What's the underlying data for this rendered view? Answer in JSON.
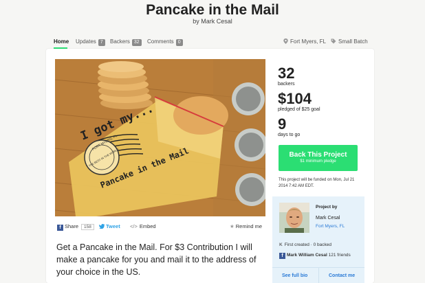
{
  "project": {
    "title": "Pancake in the Mail",
    "byline": "by Mark Cesal"
  },
  "nav": {
    "home": "Home",
    "updates": "Updates",
    "updates_count": "7",
    "backers": "Backers",
    "backers_count": "32",
    "comments": "Comments",
    "comments_count": "0",
    "location": "Fort Myers, FL",
    "category": "Small Batch"
  },
  "hero_image": {
    "bag_text_1": "I got my...",
    "bag_text_2": "Pancake in the Mail",
    "stamp_text_top": "FORT MYERS, FL",
    "stamp_text_bottom": "THE BEST IN THE WORLD"
  },
  "share": {
    "facebook_label": "Share",
    "facebook_count": "158",
    "tweet_label": "Tweet",
    "embed_label": "Embed",
    "remind_label": "Remind me"
  },
  "description": "Get a Pancake in the Mail. For $3 Contribution I will make a pancake for you and mail it to the address of your choice in the US.",
  "stats": {
    "backers_value": "32",
    "backers_label": "backers",
    "pledged_value": "$104",
    "pledged_label": "pledged of $25 goal",
    "days_value": "9",
    "days_label": "days to go"
  },
  "back_button": {
    "label": "Back This Project",
    "sub": "$1 minimum pledge"
  },
  "funded_note": "This project will be funded on Mon, Jul 21 2014 7:42 AM EDT.",
  "creator": {
    "label": "Project by",
    "name": "Mark Cesal",
    "location": "Fort Myers, FL",
    "history": "First created · 0 backed",
    "facebook_name": "Mark William Cesal",
    "facebook_friends": "121 friends",
    "bio_link": "See full bio",
    "contact_link": "Contact me"
  },
  "colors": {
    "accent_green": "#2bde73",
    "link_blue": "#2a7ad6",
    "creator_bg": "#e6f2fa"
  }
}
